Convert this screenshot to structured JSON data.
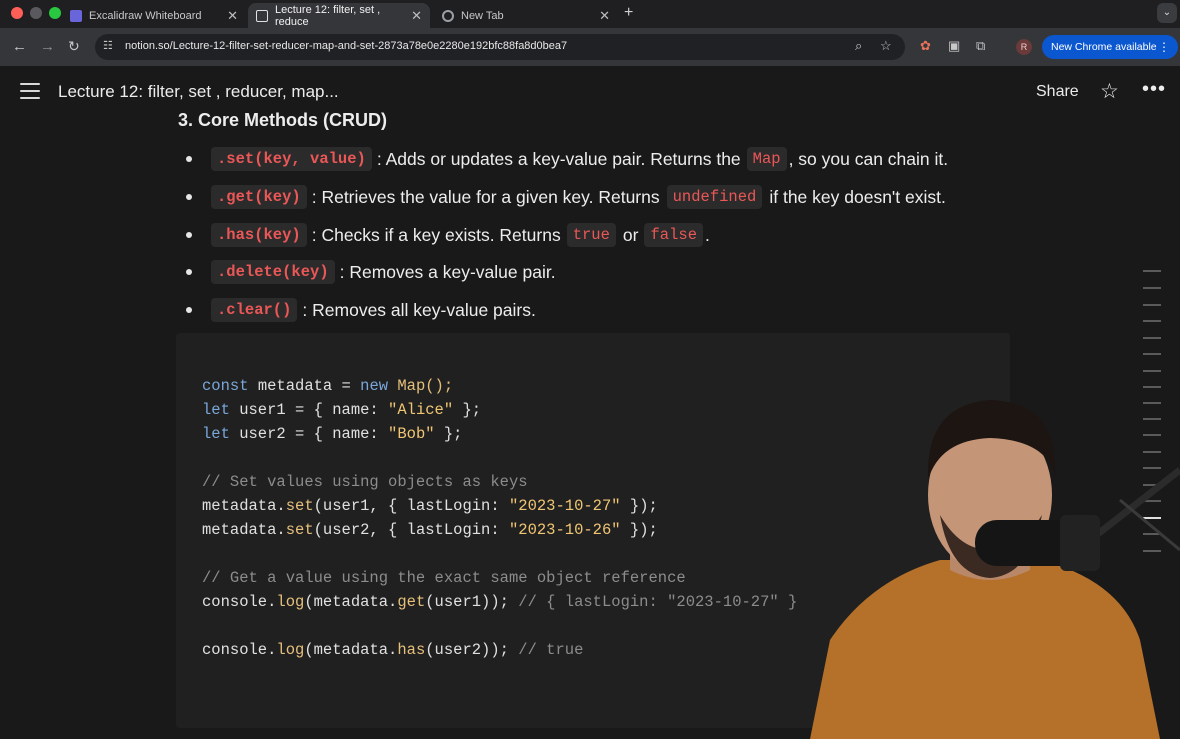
{
  "browser": {
    "tabs": [
      {
        "label": "Excalidraw Whiteboard"
      },
      {
        "label": "Lecture 12: filter, set , reduce"
      },
      {
        "label": "New Tab"
      }
    ],
    "url": "notion.so/Lecture-12-filter-set-reducer-map-and-set-2873a78e0e2280e192bfc88fa8d0bea7",
    "avatar_initial": "R",
    "update_label": "New Chrome available"
  },
  "header": {
    "title": "Lecture 12: filter, set , reducer, map...",
    "share_label": "Share"
  },
  "content": {
    "heading": "3. Core Methods (CRUD)",
    "bullets": [
      {
        "code": ".set(key, value)",
        "text": ": Adds or updates a key-value pair. Returns the",
        "code2": "Map",
        "text2": ", so you can chain it."
      },
      {
        "code": ".get(key)",
        "text": ": Retrieves the value for a given key. Returns",
        "code2": "undefined",
        "text2": "if the key doesn't exist."
      },
      {
        "code": ".has(key)",
        "text": ": Checks if a key exists. Returns",
        "code2": "true",
        "text2": "or",
        "code3": "false",
        "text3": "."
      },
      {
        "code": ".delete(key)",
        "text": ": Removes a key-value pair."
      },
      {
        "code": ".clear()",
        "text": ": Removes all key-value pairs."
      }
    ],
    "code": {
      "l1": {
        "a": "const",
        "b": " metadata = ",
        "c": "new",
        "d": " Map();"
      },
      "l2": {
        "a": "let",
        "b": " user1 = { name: ",
        "c": "\"Alice\"",
        "d": " };"
      },
      "l3": {
        "a": "let",
        "b": " user2 = { name: ",
        "c": "\"Bob\"",
        "d": " };"
      },
      "l4": "// Set values using objects as keys",
      "l5": {
        "a": "metadata.",
        "b": "set",
        "c": "(user1, { lastLogin: ",
        "d": "\"2023-10-27\"",
        "e": " });"
      },
      "l6": {
        "a": "metadata.",
        "b": "set",
        "c": "(user2, { lastLogin: ",
        "d": "\"2023-10-26\"",
        "e": " });"
      },
      "l7": "// Get a value using the exact same object reference",
      "l8": {
        "a": "console.",
        "b": "log",
        "c": "(metadata.",
        "d": "get",
        "e": "(user1)); ",
        "f": "// { lastLogin: \"2023-10-27\" }"
      },
      "l9": {
        "a": "console.",
        "b": "log",
        "c": "(metadata.",
        "d": "has",
        "e": "(user2)); ",
        "f": "// true"
      }
    }
  },
  "colors": {
    "background": "#191919",
    "inline_code": "#eb5757",
    "update_pill": "#0b57d0"
  }
}
